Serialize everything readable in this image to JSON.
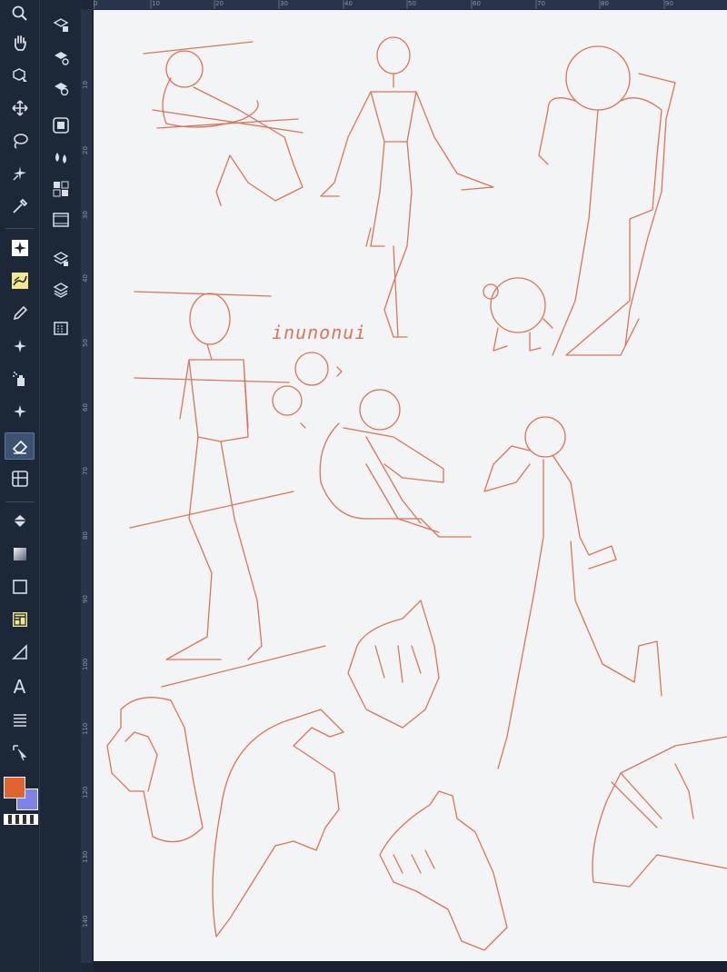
{
  "toolbar": {
    "tools": [
      {
        "name": "zoom-tool",
        "icon": "magnifier-icon"
      },
      {
        "name": "hand-tool",
        "icon": "hand-icon"
      },
      {
        "name": "object-tool",
        "icon": "object-select-icon"
      },
      {
        "name": "move-tool",
        "icon": "move-arrows-icon"
      },
      {
        "name": "lasso-tool",
        "icon": "lasso-icon"
      },
      {
        "name": "magic-wand-tool",
        "icon": "magic-wand-icon"
      },
      {
        "name": "eyedropper-tool",
        "icon": "eyedropper-icon"
      },
      {
        "name": "sparkle-tool",
        "icon": "sparkle-icon"
      },
      {
        "name": "brush-tool",
        "icon": "brush-icon"
      },
      {
        "name": "pen-tool",
        "icon": "pen-icon"
      },
      {
        "name": "decoration-tool",
        "icon": "sparkle-icon"
      },
      {
        "name": "airbrush-tool",
        "icon": "airbrush-icon"
      },
      {
        "name": "decoration-tool-2",
        "icon": "sparkle-icon"
      },
      {
        "name": "eraser-tool",
        "icon": "eraser-icon",
        "active": true
      },
      {
        "name": "blend-tool",
        "icon": "blend-icon"
      },
      {
        "name": "fill-tool",
        "icon": "bucket-icon"
      },
      {
        "name": "gradient-tool",
        "icon": "gradient-icon"
      },
      {
        "name": "figure-tool",
        "icon": "rectangle-icon"
      },
      {
        "name": "frame-tool",
        "icon": "frame-icon"
      },
      {
        "name": "ruler-tool",
        "icon": "ruler-icon"
      },
      {
        "name": "text-tool",
        "icon": "text-icon"
      },
      {
        "name": "balloon-tool",
        "icon": "lines-icon"
      },
      {
        "name": "correct-line-tool",
        "icon": "correct-line-icon"
      }
    ],
    "text_tool_glyph": "A",
    "main_color": "#e0642c",
    "sub_color": "#7f82e8"
  },
  "subbar": {
    "items": [
      "layer-property-icon",
      "layer-settings-icon",
      "layer-search-icon",
      "navigator-icon",
      "color-mix-icon",
      "material-icon",
      "animation-icon",
      "layer-stack-icon",
      "layers-icon",
      "file-icon"
    ]
  },
  "rulers": {
    "horizontal": [
      "0",
      "10",
      "20",
      "30",
      "40",
      "50",
      "60",
      "70",
      "80",
      "90"
    ],
    "vertical": [
      "10",
      "20",
      "30",
      "40",
      "50",
      "60",
      "70",
      "80",
      "90",
      "100",
      "110",
      "120",
      "130",
      "140"
    ]
  },
  "canvas": {
    "sketch_color": "#d9755a",
    "handwriting": "inunonui"
  }
}
